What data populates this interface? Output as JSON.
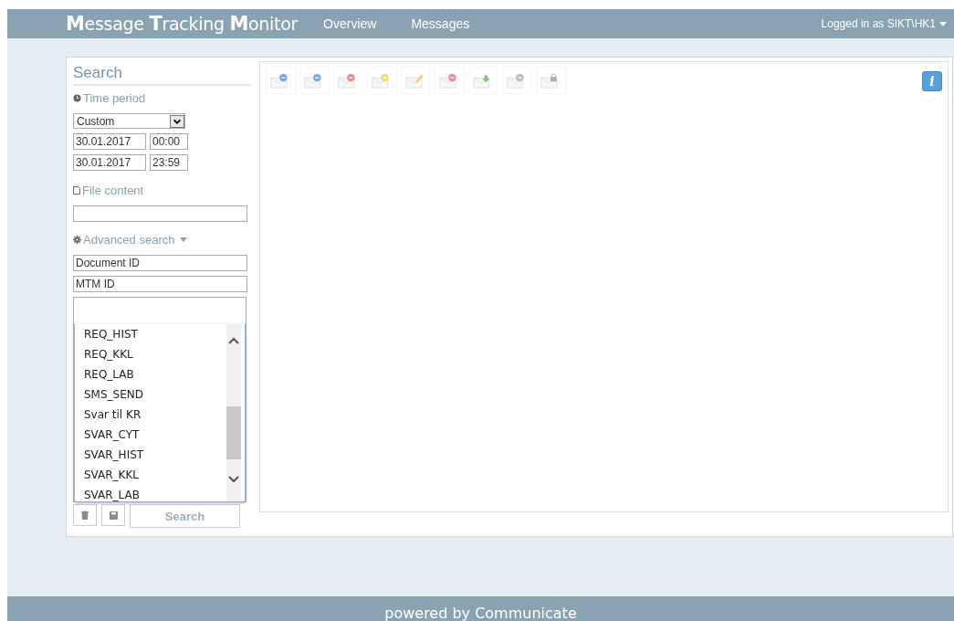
{
  "header": {
    "title": "**M**essage **T**racking **M**onitor",
    "nav": [
      {
        "label": "Overview",
        "selected": false
      },
      {
        "label": "Messages",
        "selected": false
      }
    ],
    "user_menu": "Logged in as SIKT\\HK1"
  },
  "search": {
    "heading": "Search",
    "time_period": {
      "label": "Time period",
      "range": "Custom",
      "from_date": "30.01.2017",
      "from_time": "00:00",
      "to_date": "30.01.2017",
      "to_time": "23:59"
    },
    "file_content": {
      "label": "File content"
    },
    "advanced": {
      "label": "Advanced search",
      "expanded": true,
      "document_id": {
        "placeholder": "Document ID"
      },
      "mtm_id": {
        "placeholder": "MTM ID"
      }
    },
    "message_types": [
      {
        "label": "REQ_HIST",
        "selected": false
      },
      {
        "label": "REQ_KKL",
        "selected": false
      },
      {
        "label": "REQ_LAB",
        "selected": false
      },
      {
        "label": "SMS_SEND",
        "selected": false
      },
      {
        "label": "Svar til KR",
        "selected": false
      },
      {
        "label": "SVAR_CYT",
        "selected": false
      },
      {
        "label": "SVAR_HIST",
        "selected": false
      },
      {
        "label": "SVAR_KKL",
        "selected": false
      },
      {
        "label": "SVAR_LAB",
        "selected": false
      }
    ],
    "search_button": "Search"
  },
  "info_button": "i",
  "footer": "powered by Communicate"
}
